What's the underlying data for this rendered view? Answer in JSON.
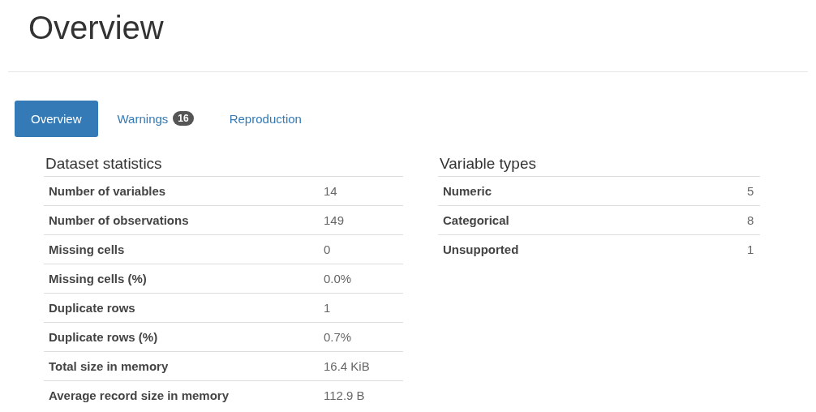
{
  "title": "Overview",
  "tabs": [
    {
      "label": "Overview",
      "selected": true
    },
    {
      "label": "Warnings",
      "badge": "16",
      "selected": false
    },
    {
      "label": "Reproduction",
      "selected": false
    }
  ],
  "panels": [
    {
      "heading": "Dataset statistics",
      "rows": [
        {
          "label": "Number of variables",
          "value": "14"
        },
        {
          "label": "Number of observations",
          "value": "149"
        },
        {
          "label": "Missing cells",
          "value": "0"
        },
        {
          "label": "Missing cells (%)",
          "value": "0.0%"
        },
        {
          "label": "Duplicate rows",
          "value": "1"
        },
        {
          "label": "Duplicate rows (%)",
          "value": "0.7%"
        },
        {
          "label": "Total size in memory",
          "value": "16.4 KiB"
        },
        {
          "label": "Average record size in memory",
          "value": "112.9 B"
        }
      ]
    },
    {
      "heading": "Variable types",
      "rows": [
        {
          "label": "Numeric",
          "value": "5"
        },
        {
          "label": "Categorical",
          "value": "8"
        },
        {
          "label": "Unsupported",
          "value": "1"
        }
      ]
    }
  ]
}
